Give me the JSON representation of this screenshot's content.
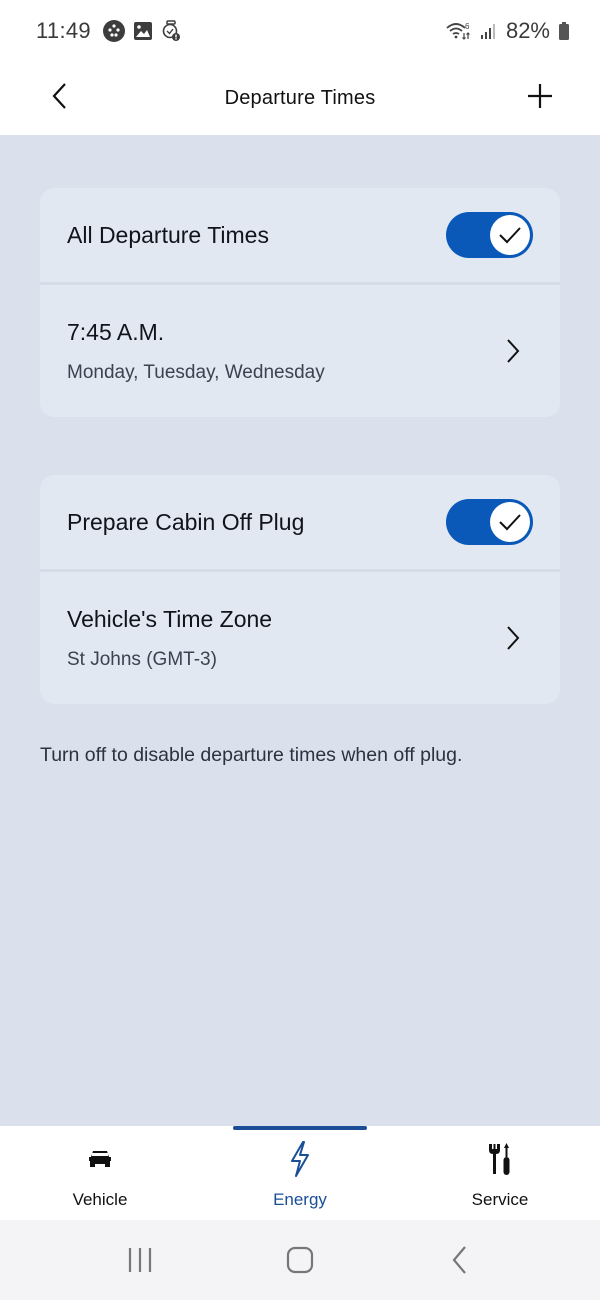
{
  "status_bar": {
    "time": "11:49",
    "left_icons": [
      "app-dots-icon",
      "gallery-icon",
      "watch-alarm-icon"
    ],
    "right_icons": [
      "wifi-6-icon",
      "signal-icon",
      "battery-icon"
    ],
    "battery_percent": "82%"
  },
  "header": {
    "title": "Departure Times",
    "back_icon": "chevron-left-icon",
    "add_icon": "plus-icon"
  },
  "cards": [
    {
      "toggle_row": {
        "label": "All Departure Times",
        "enabled": true
      },
      "link_row": {
        "title": "7:45 A.M.",
        "subtitle": "Monday, Tuesday, Wednesday"
      }
    },
    {
      "toggle_row": {
        "label": "Prepare Cabin Off Plug",
        "enabled": true
      },
      "link_row": {
        "title": "Vehicle's Time Zone",
        "subtitle": "St Johns (GMT-3)"
      }
    }
  ],
  "helper_text": "Turn off to disable departure times when off plug.",
  "bottom_nav": {
    "active": "Energy",
    "items": [
      {
        "label": "Vehicle",
        "icon": "car-icon"
      },
      {
        "label": "Energy",
        "icon": "lightning-icon"
      },
      {
        "label": "Service",
        "icon": "tools-icon"
      }
    ]
  },
  "system_nav": {
    "buttons": [
      "recents-icon",
      "home-icon",
      "back-icon"
    ]
  },
  "colors": {
    "accent": "#0a58b8",
    "active_nav": "#1a4f98",
    "background": "#dae0ec",
    "card": "#e2e8f2"
  }
}
